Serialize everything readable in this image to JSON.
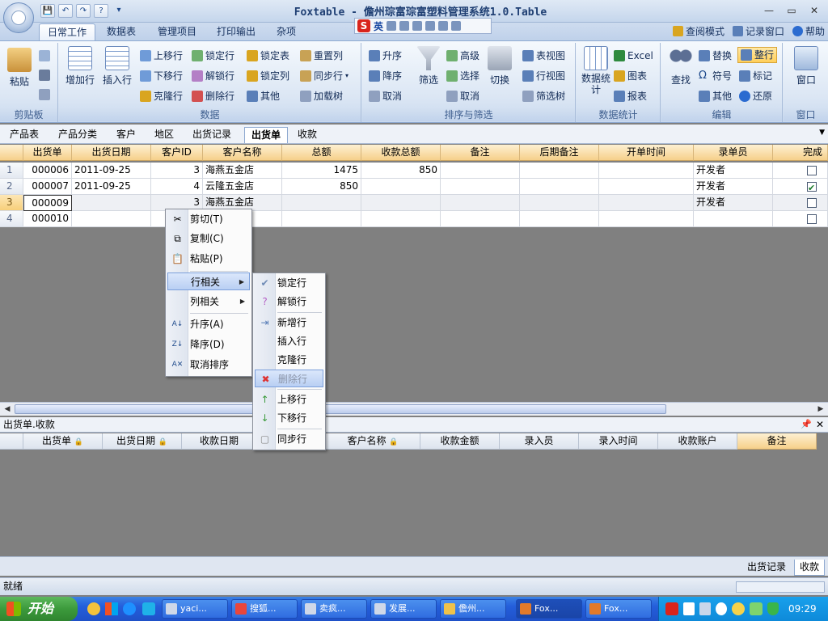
{
  "app": {
    "title": "Foxtable - 儋州琮富琮富塑料管理系统1.0.Table",
    "qat": [
      "💾",
      "↶",
      "↷",
      "?",
      "▾"
    ]
  },
  "ime": {
    "logo": "S",
    "lang": "英"
  },
  "ribbon_tabs": [
    "日常工作",
    "数据表",
    "管理项目",
    "打印输出",
    "杂项"
  ],
  "right_links": [
    "查阅模式",
    "记录窗口",
    "帮助"
  ],
  "groups": {
    "clipboard": {
      "label": "剪贴板",
      "paste": "粘贴"
    },
    "data": {
      "label": "数据",
      "add_row": "增加行",
      "insert_row": "插入行",
      "items": [
        "上移行",
        "锁定行",
        "下移行",
        "解锁行",
        "克隆行",
        "删除行"
      ]
    },
    "lock": {
      "items": [
        "锁定表",
        "重置列",
        "锁定列",
        "同步行",
        "其他",
        "加载树"
      ]
    },
    "sort": {
      "label": "排序与筛选",
      "items": [
        "升序",
        "降序",
        "取消"
      ],
      "filter": "筛选",
      "filter_items": [
        "高级",
        "选择",
        "取消"
      ],
      "toggle": "切换",
      "views": [
        "表视图",
        "行视图",
        "筛选树"
      ]
    },
    "stats": {
      "label": "数据统计",
      "data_stats": "数据统计",
      "items": [
        "Excel",
        "图表",
        "报表"
      ]
    },
    "edit": {
      "label": "编辑",
      "find": "查找",
      "items": [
        "替换",
        "整行",
        "符号",
        "标记",
        "其他",
        "还原"
      ]
    },
    "window": {
      "label": "窗口",
      "win": "窗口"
    }
  },
  "doc_tabs": [
    "产品表",
    "产品分类",
    "客户",
    "地区",
    "出货记录",
    "出货单",
    "收款"
  ],
  "grid": {
    "columns": [
      "出货单",
      "出货日期",
      "客户ID",
      "客户名称",
      "总额",
      "收款总额",
      "备注",
      "后期备注",
      "开单时间",
      "录单员",
      "完成"
    ],
    "rows": [
      {
        "n": "1",
        "order": "000006",
        "date": "2011-09-25",
        "cid": "3",
        "cname": "海燕五金店",
        "total": "1475",
        "recv": "850",
        "clerk": "开发者",
        "done": false
      },
      {
        "n": "2",
        "order": "000007",
        "date": "2011-09-25",
        "cid": "4",
        "cname": "云隆五金店",
        "total": "850",
        "recv": "",
        "clerk": "开发者",
        "done": true
      },
      {
        "n": "3",
        "order": "000009",
        "date": "",
        "cid": "3",
        "cname": "海燕五金店",
        "total": "",
        "recv": "",
        "clerk": "开发者",
        "done": false
      },
      {
        "n": "4",
        "order": "000010",
        "date": "",
        "cid": "",
        "cname": "",
        "total": "",
        "recv": "",
        "clerk": "",
        "done": false
      }
    ]
  },
  "context_menu": {
    "items": [
      "剪切(T)",
      "复制(C)",
      "粘贴(P)",
      "行相关",
      "列相关",
      "升序(A)",
      "降序(D)",
      "取消排序"
    ]
  },
  "row_submenu": {
    "items": [
      "锁定行",
      "解锁行",
      "新增行",
      "插入行",
      "克隆行",
      "删除行",
      "上移行",
      "下移行",
      "同步行"
    ]
  },
  "subtable": {
    "title": "出货单.收款",
    "columns": [
      "出货单",
      "出货日期",
      "收款日期",
      "客户名称",
      "收款金额",
      "录入员",
      "录入时间",
      "收款账户",
      "备注"
    ]
  },
  "bottom_tabs": [
    "出货记录",
    "收款"
  ],
  "status": "就绪",
  "taskbar": {
    "start": "开始",
    "items": [
      "yaci...",
      "搜狐...",
      "卖疯...",
      "发展...",
      "儋州...",
      "Fox...",
      "Fox..."
    ],
    "clock": "09:29"
  }
}
